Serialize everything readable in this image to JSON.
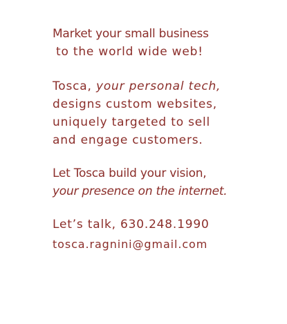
{
  "content": {
    "headline": {
      "line1": "Market your small business",
      "line2": "to the world wide web!"
    },
    "intro": {
      "brand": "Tosca,",
      "role": "your personal tech,",
      "line2": "designs custom websites,",
      "line3": "uniquely targeted to sell",
      "line4": "and engage customers."
    },
    "vision": {
      "line1": "Let Tosca build your vision,",
      "line2": "your presence on the internet."
    },
    "contact": {
      "prompt": "Let’s talk, 630.248.1990",
      "email": "tosca.ragnini@gmail.com"
    }
  },
  "colors": {
    "text": "#8b2e2a",
    "background": "#ffffff"
  }
}
